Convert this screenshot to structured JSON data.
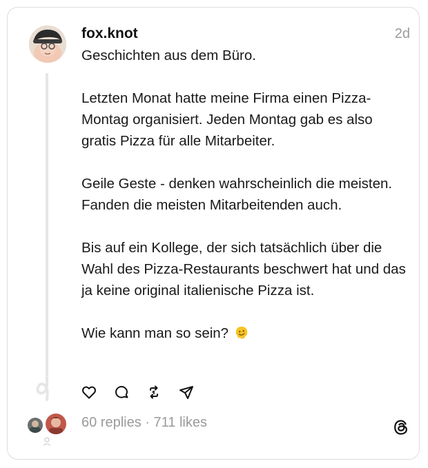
{
  "post": {
    "username": "fox.knot",
    "timestamp": "2d",
    "paragraphs": [
      "Geschichten aus dem Büro.",
      "Letzten Monat hatte meine Firma einen Pizza-Montag organisiert. Jeden Montag gab es also gratis Pizza für alle Mitarbeiter.",
      "Geile Geste - denken wahrscheinlich die meisten. Fanden die meisten Mitarbeitenden auch.",
      "Bis auf ein Kollege, der sich tatsächlich über die Wahl des Pizza-Restaurants beschwert hat und das ja keine original italienische Pizza ist.",
      "Wie kann man so sein?"
    ],
    "emoji_icon": "melting-face-emoji"
  },
  "actions": {
    "like_icon": "heart-icon",
    "reply_icon": "comment-icon",
    "repost_icon": "repost-icon",
    "share_icon": "send-icon"
  },
  "stats": {
    "replies": "60 replies",
    "separator": " · ",
    "likes": "711 likes"
  },
  "colors": {
    "muted": "#9a9a9a",
    "border": "#dcdcdc",
    "thread_line": "#e6e6e6"
  }
}
